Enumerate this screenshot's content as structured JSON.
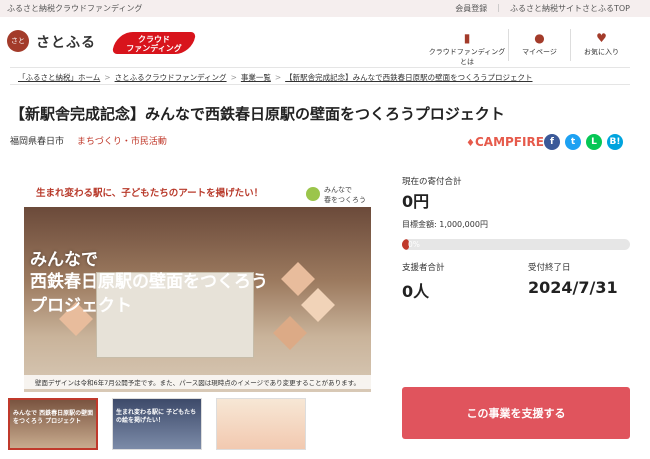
{
  "topbar": {
    "site_tagline": "ふるさと納税クラウドファンディング",
    "links": [
      "会員登録",
      "ふるさと納税サイトさとふるTOP"
    ]
  },
  "header": {
    "logo_mark": "さと",
    "logo_text": "さとふる",
    "badge_line1": "クラウド",
    "badge_line2": "ファンディング",
    "nav": [
      {
        "icon": "book-icon",
        "label": "クラウドファンディングとは"
      },
      {
        "icon": "user-icon",
        "label": "マイページ"
      },
      {
        "icon": "heart-icon",
        "label": "お気に入り"
      }
    ]
  },
  "breadcrumb": [
    "「ふるさと納税」ホーム",
    "さとふるクラウドファンディング",
    "事業一覧",
    "【新駅舎完成記念】みんなで西鉄春日原駅の壁面をつくろうプロジェクト"
  ],
  "project": {
    "title": "【新駅舎完成記念】みんなで西鉄春日原駅の壁面をつくろうプロジェクト",
    "city": "福岡県春日市",
    "category": "まちづくり・市民活動",
    "platform": "CAMPFIRE"
  },
  "social": [
    {
      "name": "facebook",
      "glyph": "f",
      "color": "#3b5998"
    },
    {
      "name": "twitter",
      "glyph": "t",
      "color": "#1da1f2"
    },
    {
      "name": "line",
      "glyph": "L",
      "color": "#06c755"
    },
    {
      "name": "hatena",
      "glyph": "B!",
      "color": "#00a4de"
    }
  ],
  "hero": {
    "tagline": "生まれ変わる駅に、子どもたちのアートを掲げたい！",
    "brand_line1": "みんなで",
    "brand_line2": "春をつくろう",
    "headline1": "みんなで",
    "headline2": "西鉄春日原駅の壁面をつくろう",
    "headline3": "プロジェクト",
    "caption": "壁面デザインは令和6年7月公開予定です。また、パース図は現時点のイメージであり変更することがあります。"
  },
  "thumbs": [
    {
      "text": "みんなで 西鉄春日原駅の壁面をつくろう プロジェクト"
    },
    {
      "text": "生まれ変わる駅に 子どもたちの絵を掲げたい！"
    },
    {
      "text": ""
    }
  ],
  "stats": {
    "raised_label": "現在の寄付合計",
    "raised_value": "0円",
    "goal_label": "目標金額: 1,000,000円",
    "progress_percent": 0,
    "progress_text": "0%",
    "supporters_label": "支援者合計",
    "supporters_value": "0人",
    "end_label": "受付終了日",
    "end_value": "2024/7/31"
  },
  "cta": {
    "label": "この事業を支援する"
  },
  "colors": {
    "accent": "#c0392b",
    "button": "#e0545d",
    "topbar": "#f5eeee"
  }
}
